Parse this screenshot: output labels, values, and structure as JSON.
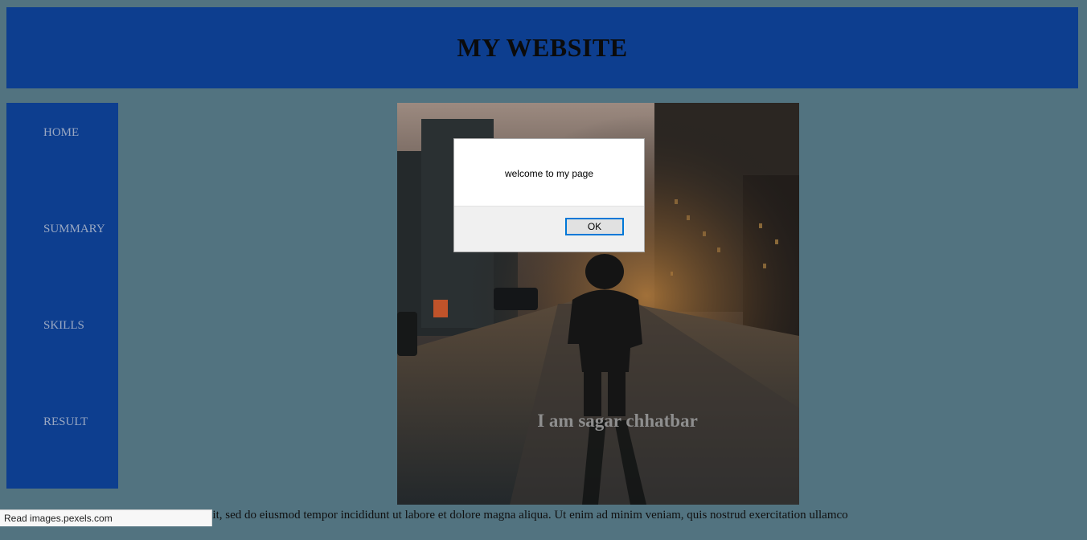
{
  "header": {
    "title": "MY WEBSITE"
  },
  "sidebar": {
    "items": [
      {
        "label": "HOME"
      },
      {
        "label": "SUMMARY"
      },
      {
        "label": "SKILLS"
      },
      {
        "label": "RESULT"
      }
    ]
  },
  "hero": {
    "caption": "I am sagar chhatbar"
  },
  "content": {
    "paragraph": "Lorem ipsum dolor sit amet, consectetur adipiscing elit, sed do eiusmod tempor incididunt ut labore et dolore magna aliqua. Ut enim ad minim veniam, quis nostrud exercitation ullamco"
  },
  "dialog": {
    "message": "welcome to my page",
    "ok_label": "OK"
  },
  "statusbar": {
    "text": "Read images.pexels.com"
  },
  "colors": {
    "page_bg": "#527380",
    "panel_blue": "#0d3e8f",
    "dialog_focus": "#0078d7"
  }
}
